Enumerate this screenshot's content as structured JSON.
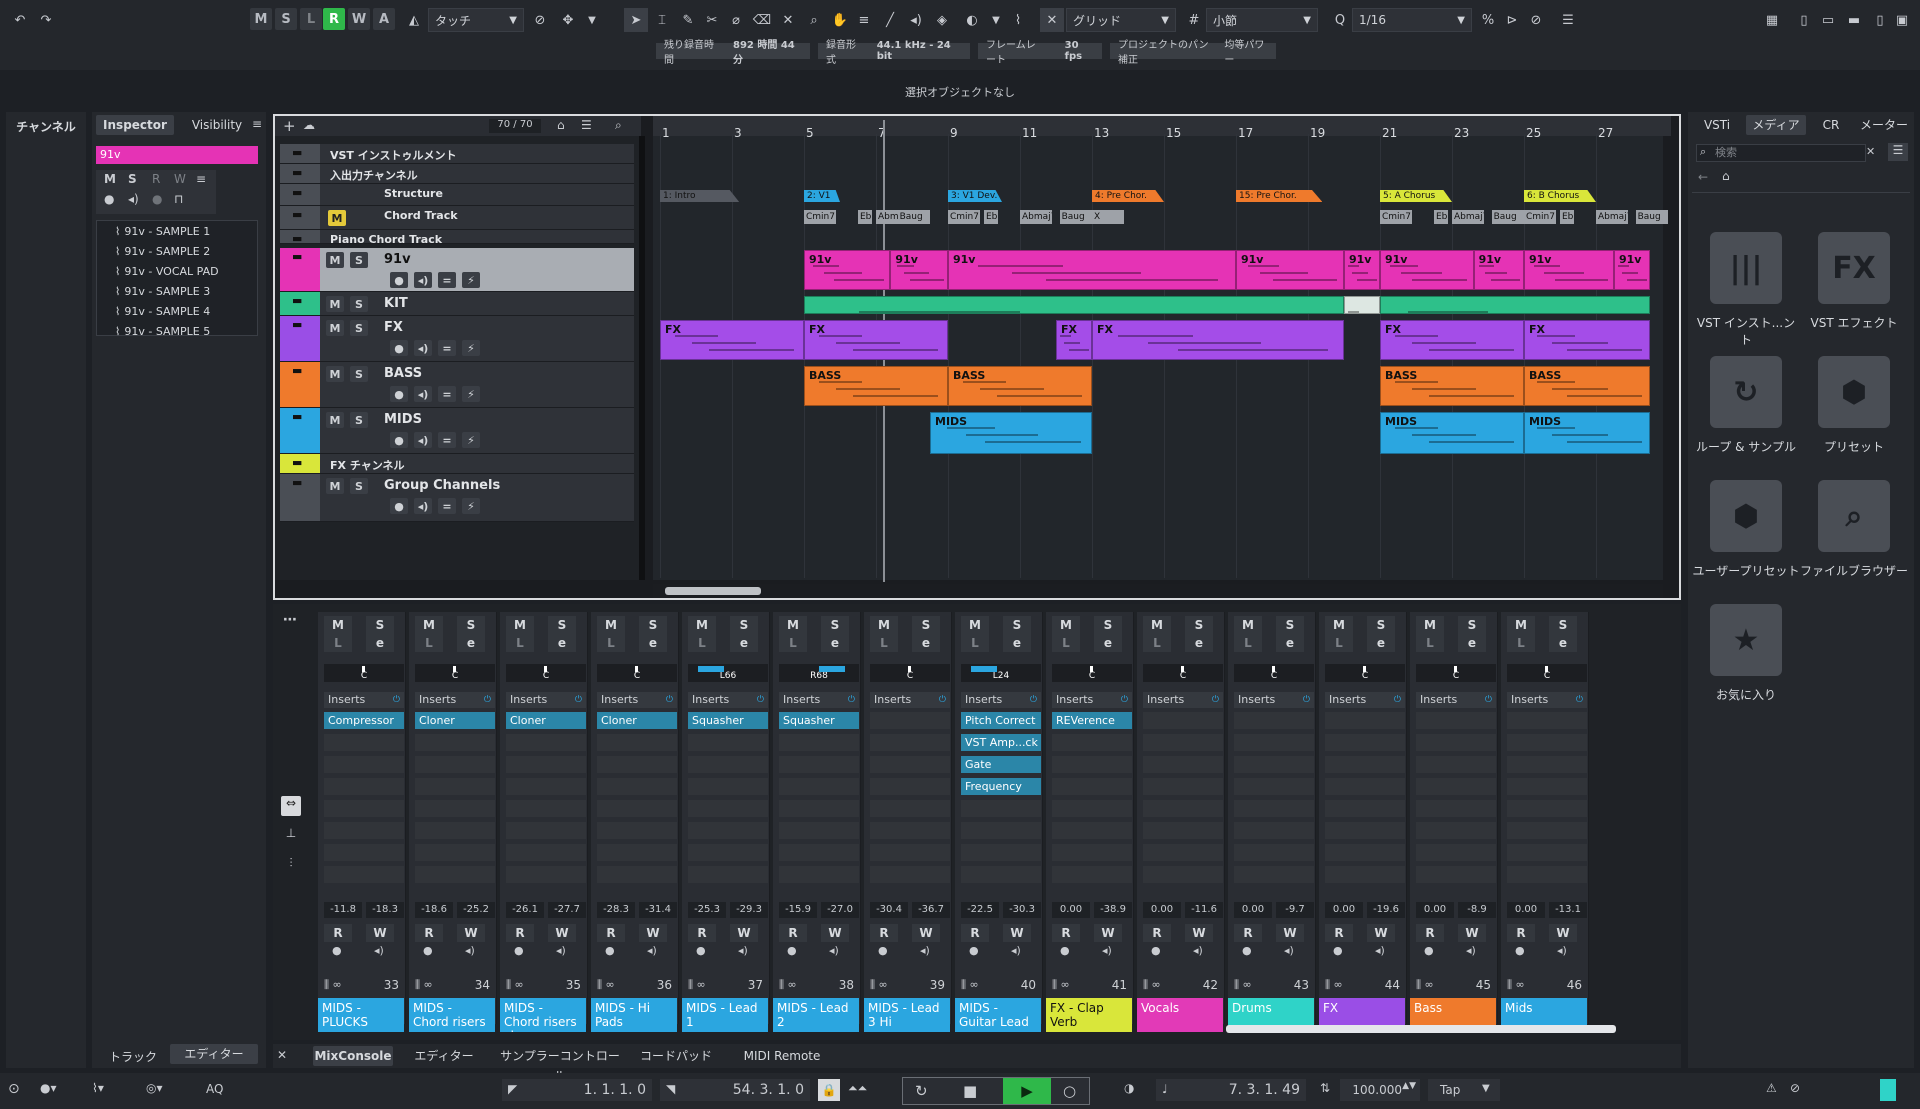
{
  "toolbar": {
    "mute_solo": [
      "M",
      "S",
      "L",
      "R",
      "W",
      "A"
    ],
    "automation_mode": "タッチ",
    "snap_type": "グリッド",
    "grid_type": "小節",
    "quantize": "1/16"
  },
  "infobar": {
    "rec_time_label": "残り録音時間",
    "rec_time_value": "892 時間 44 分",
    "rec_format_label": "録音形式",
    "rec_format_value": "44.1 kHz - 24 bit",
    "frame_rate_label": "フレームレート",
    "frame_rate_value": "30 fps",
    "pan_label": "プロジェクトのパン補正",
    "pan_value": "均等パワー"
  },
  "status_line": "選択オブジェクトなし",
  "left_zone": {
    "channel_tab": "チャンネル",
    "inspector_tab": "Inspector",
    "visibility_tab": "Visibility",
    "track_name": "91v",
    "samples": [
      "91v - SAMPLE 1",
      "91v - SAMPLE 2",
      "91v - VOCAL PAD",
      "91v - SAMPLE 3",
      "91v - SAMPLE 4",
      "91v - SAMPLE 5"
    ],
    "bottom_tabs": [
      "トラック",
      "エディター"
    ]
  },
  "project": {
    "track_count": "70 / 70",
    "tracks": [
      {
        "name": "VST インストゥルメント"
      },
      {
        "name": "入出力チャンネル"
      },
      {
        "name": "Structure"
      },
      {
        "name": "Chord Track"
      },
      {
        "name": "Piano Chord Track"
      },
      {
        "name": "91v"
      },
      {
        "name": "KIT"
      },
      {
        "name": "FX"
      },
      {
        "name": "BASS"
      },
      {
        "name": "MIDS"
      },
      {
        "name": "FX チャンネル"
      },
      {
        "name": "Group Channels"
      }
    ],
    "ruler": [
      "1",
      "3",
      "5",
      "7",
      "9",
      "11",
      "13",
      "15",
      "17",
      "19",
      "21",
      "23",
      "25",
      "27"
    ],
    "sections": [
      "1: Intro",
      "2: V1",
      "3: V1 Dev.",
      "4: Pre Chor.",
      "15: Pre Chor.",
      "5: A Chorus",
      "6: B Chorus"
    ],
    "chords": [
      "Cmin7",
      "Eb",
      "Abmaj7",
      "Baug",
      "X"
    ],
    "clip_labels": {
      "v91": "91v",
      "fx": "FX",
      "bass": "BASS",
      "mids": "MIDS"
    }
  },
  "mixer": {
    "strips": [
      {
        "pan": "C",
        "plugins": [
          "Compressor"
        ],
        "vals": [
          "-11.8",
          "-18.3"
        ],
        "num": "33",
        "name": "MIDS - PLUCKS",
        "color": "#2ba6e0"
      },
      {
        "pan": "C",
        "plugins": [
          "Cloner"
        ],
        "vals": [
          "-18.6",
          "-25.2"
        ],
        "num": "34",
        "name": "MIDS - Chord risers",
        "color": "#2ba6e0"
      },
      {
        "pan": "C",
        "plugins": [
          "Cloner"
        ],
        "vals": [
          "-26.1",
          "-27.7"
        ],
        "num": "35",
        "name": "MIDS - Chord risers chorus",
        "color": "#2ba6e0"
      },
      {
        "pan": "C",
        "plugins": [
          "Cloner"
        ],
        "vals": [
          "-28.3",
          "-31.4"
        ],
        "num": "36",
        "name": "MIDS - Hi Pads",
        "color": "#2ba6e0"
      },
      {
        "pan": "L66",
        "plugins": [
          "Squasher"
        ],
        "vals": [
          "-25.3",
          "-29.3"
        ],
        "num": "37",
        "name": "MIDS - Lead 1",
        "color": "#2ba6e0"
      },
      {
        "pan": "R68",
        "plugins": [
          "Squasher"
        ],
        "vals": [
          "-15.9",
          "-27.0"
        ],
        "num": "38",
        "name": "MIDS - Lead 2",
        "color": "#2ba6e0"
      },
      {
        "pan": "C",
        "plugins": [],
        "vals": [
          "-30.4",
          "-36.7"
        ],
        "num": "39",
        "name": "MIDS - Lead 3 Hi",
        "color": "#2ba6e0"
      },
      {
        "pan": "L24",
        "plugins": [
          "Pitch Correct",
          "VST Amp...ck",
          "Gate",
          "Frequency"
        ],
        "vals": [
          "-22.5",
          "-30.3"
        ],
        "num": "40",
        "name": "MIDS - Guitar Lead",
        "color": "#2ba6e0"
      },
      {
        "pan": "C",
        "plugins": [
          "REVerence"
        ],
        "vals": [
          "0.00",
          "-38.9"
        ],
        "num": "41",
        "name": "FX - Clap Verb",
        "color": "#d9e63a"
      },
      {
        "pan": "C",
        "plugins": [],
        "vals": [
          "0.00",
          "-11.6"
        ],
        "num": "42",
        "name": "Vocals",
        "color": "#e23ab7"
      },
      {
        "pan": "C",
        "plugins": [],
        "vals": [
          "0.00",
          "-9.7"
        ],
        "num": "43",
        "name": "Drums",
        "color": "#2fd3c8"
      },
      {
        "pan": "C",
        "plugins": [],
        "vals": [
          "0.00",
          "-19.6"
        ],
        "num": "44",
        "name": "FX",
        "color": "#9a4ee6"
      },
      {
        "pan": "C",
        "plugins": [],
        "vals": [
          "0.00",
          "-8.9"
        ],
        "num": "45",
        "name": "Bass",
        "color": "#ef7a2c"
      },
      {
        "pan": "C",
        "plugins": [],
        "vals": [
          "0.00",
          "-13.1"
        ],
        "num": "46",
        "name": "Mids",
        "color": "#2ba6e0"
      }
    ],
    "inserts_label": "Inserts",
    "bottom_tabs": [
      "MixConsole",
      "エディター",
      "サンプラーコントロール",
      "コードパッド",
      "MIDI Remote"
    ]
  },
  "right_zone": {
    "tabs": [
      "VSTi",
      "メディア",
      "CR",
      "メーター"
    ],
    "search_placeholder": "検索",
    "tiles": [
      {
        "label": "VST インスト...ント",
        "glyph": "|||"
      },
      {
        "label": "VST エフェクト",
        "glyph": "FX"
      },
      {
        "label": "ループ & サンプル",
        "glyph": "↻"
      },
      {
        "label": "プリセット",
        "glyph": "⬢"
      },
      {
        "label": "ユーザープリセット",
        "glyph": "⬢"
      },
      {
        "label": "ファイルブラウザー",
        "glyph": "⌕"
      },
      {
        "label": "お気に入り",
        "glyph": "★"
      }
    ]
  },
  "transport": {
    "left_locator": "1. 1. 1.  0",
    "right_locator": "54. 3. 1.  0",
    "position": "7. 3. 1. 49",
    "tempo": "100.000",
    "tap": "Tap",
    "aq": "AQ"
  }
}
